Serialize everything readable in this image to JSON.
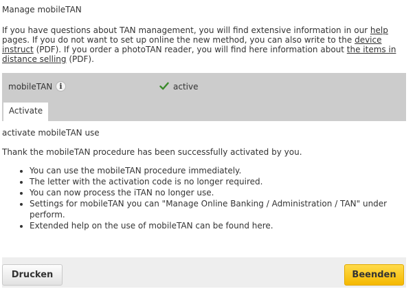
{
  "page": {
    "title": "Manage mobileTAN"
  },
  "intro": {
    "s1_before": "If you have questions about TAN management, you will find extensive information in our ",
    "s1_link": "help ",
    "s1_after": "pages. If you do not want to set up online the new method, you can also write to the ",
    "s2_link": "device instruct",
    "s2_after": " (PDF). If you order a photoTAN reader, you will find here information about ",
    "s3_link": "the items in distance selling",
    "s3_after": " (PDF)."
  },
  "panel": {
    "label": "mobileTAN",
    "info_icon": "info-icon",
    "status_icon": "checkmark-icon",
    "status": "active",
    "status_color": "#3a8a2a",
    "tab": "Activate"
  },
  "content": {
    "heading": "activate mobileTAN use",
    "message": "Thank the mobileTAN procedure has been successfully activated by you.",
    "bullets": [
      "You can use the mobileTAN procedure immediately.",
      "The letter with the activation code is no longer required.",
      "You can now process the iTAN no longer use.",
      "Settings for mobileTAN you can \"Manage Online Banking / Administration / TAN\" under perform.",
      "Extended help on the use of mobileTAN can be found here."
    ]
  },
  "buttons": {
    "print": "Drucken",
    "finish": "Beenden",
    "finish_color": "#f5b800"
  }
}
